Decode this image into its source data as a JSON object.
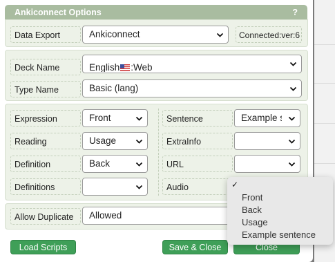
{
  "window": {
    "title": "Ankiconnect Options",
    "help": "?"
  },
  "data_export": {
    "label": "Data Export",
    "value": "Ankiconnect",
    "status": "Connected:ver:6"
  },
  "deck": {
    "label": "Deck Name",
    "value_before_flag": "English",
    "value_after_flag": ":Web",
    "flag_icon": "us-flag-icon"
  },
  "type": {
    "label": "Type Name",
    "value": "Basic (lang)"
  },
  "fields_left": [
    {
      "label": "Expression",
      "value": "Front"
    },
    {
      "label": "Reading",
      "value": "Usage"
    },
    {
      "label": "Definition",
      "value": "Back"
    },
    {
      "label": "Definitions",
      "value": ""
    }
  ],
  "fields_right": [
    {
      "label": "Sentence",
      "value": "Example sentence"
    },
    {
      "label": "ExtraInfo",
      "value": ""
    },
    {
      "label": "URL",
      "value": ""
    },
    {
      "label": "Audio",
      "value": ""
    }
  ],
  "duplicate": {
    "label": "Allow Duplicate",
    "value": "Allowed"
  },
  "buttons": {
    "load_scripts": "Load Scripts",
    "save_close": "Save & Close",
    "close": "Close"
  },
  "audio_dropdown": {
    "checked_symbol": "✓",
    "options": [
      "",
      "Front",
      "Back",
      "Usage",
      "Example sentence"
    ]
  },
  "colors": {
    "title_bar": "#a9bca0",
    "section_bg": "#edf2e8",
    "button_green": "#3f9f58"
  }
}
